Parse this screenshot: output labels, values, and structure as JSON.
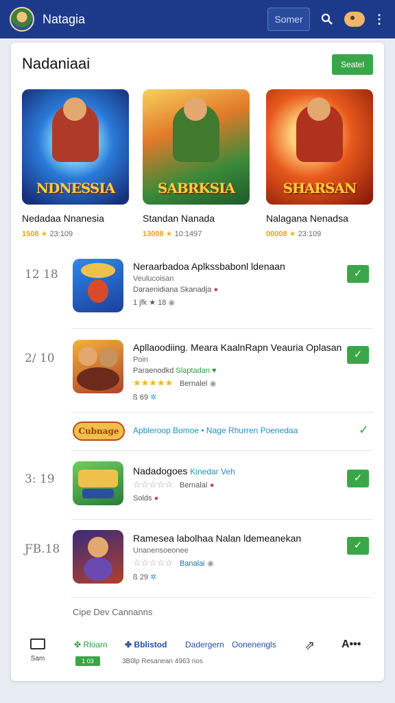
{
  "header": {
    "app_title": "Natagia",
    "search_button": "Somer",
    "icons": [
      "avatar-icon",
      "search-icon",
      "user-icon",
      "more-vertical-icon"
    ]
  },
  "featured": {
    "title": "Nadaniaai",
    "see_all": "Seatel",
    "items": [
      {
        "logo": "NDNESSIA",
        "name": "Nedadaa Nnanesia",
        "rating": "1508",
        "count": "23:109"
      },
      {
        "logo": "SABRKSIA",
        "name": "Standan Nanada",
        "rating": "13008",
        "count": "10:1497"
      },
      {
        "logo": "SHARSAN",
        "name": "Nalagana Nenadsa",
        "rating": "00008",
        "count": "23:109"
      }
    ]
  },
  "list": [
    {
      "rank": "12 18",
      "title": "Neraarbadoa Aplkssbabonl ldenaan",
      "sub": "Veulucoisan",
      "line": "Daraenidiana Skanadja",
      "foot": "1 jfk ★ 18"
    },
    {
      "rank": "2/ 10",
      "title": "Apllaoodiing. Meara KaalnRapn Veauria Oplasan",
      "sub": "Poin",
      "line": "Paraenodkd",
      "line_green": "Slaptadan",
      "stars": "★★★★★",
      "stars_label": "Bernalel",
      "foot": "ß 69"
    },
    {
      "rank": "3: 19",
      "title": "Nadadogoes",
      "title_accent": "Kinedar Veh",
      "stars": "☆☆☆☆☆",
      "stars_label": "Bernalal",
      "foot": "Solds"
    },
    {
      "rank": "ƑB.18",
      "title": "Ramesea labolhaa Nalan ldemeanekan",
      "sub": "Unanensoeonee",
      "stars": "☆☆☆☆☆",
      "stars_label": "Banalai",
      "foot": "ß 29"
    }
  ],
  "promo": {
    "badge": "Cubnage",
    "text": "Apbleroop Bomoe • Nage Rhurren Poenedaa"
  },
  "footer_note": "Cipe Dev Cannanns",
  "bottom_nav": {
    "tv_label": "Sam",
    "item1": "Rloarn",
    "item2": "Bblistod",
    "item3": "Dadergern",
    "item4": "Oonenengls",
    "pill": "1 03",
    "sub": "3B0lp Resanean 4963 nos"
  },
  "colors": {
    "header_bg": "#1d3a8a",
    "accent_green": "#3aa64a",
    "link_blue": "#1f8fb8",
    "star": "#f2b61b"
  }
}
